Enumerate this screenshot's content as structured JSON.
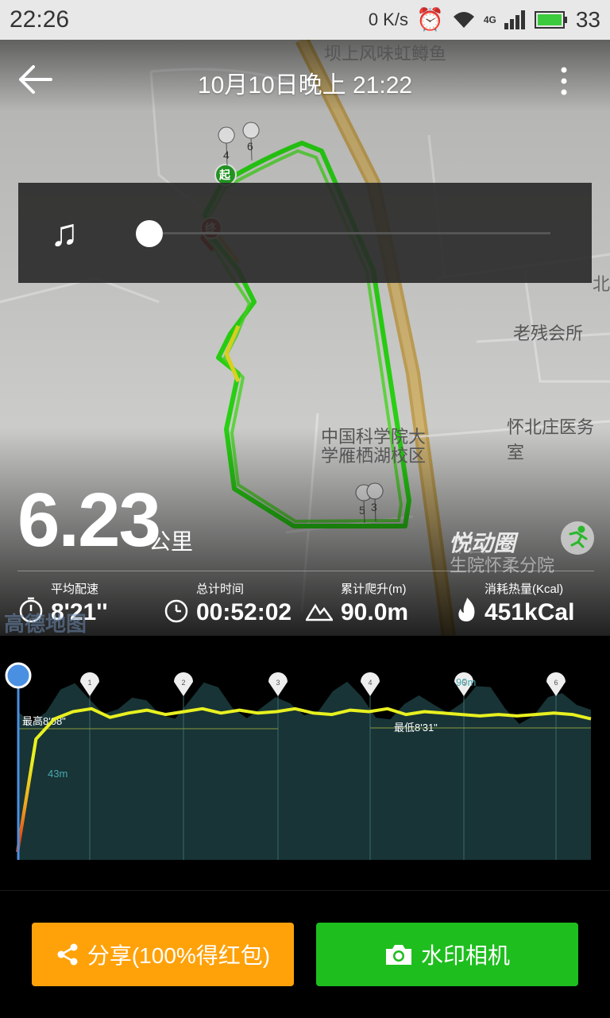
{
  "status_bar": {
    "time": "22:26",
    "net_speed": "0 K/s",
    "network_type": "4G",
    "battery": "33"
  },
  "header": {
    "title": "10月10日晚上 21:22"
  },
  "map": {
    "pois": [
      "坝上风味虹鳟鱼",
      "老残会所",
      "怀北庄医务室",
      "中国科学院大",
      "学雁栖湖校区",
      "中国",
      "生院怀柔分院",
      "北"
    ],
    "start_label": "起",
    "end_label": "终",
    "km_markers": [
      "4",
      "6",
      "5",
      "3"
    ],
    "watermark": "高德地图",
    "route_colors": {
      "fast": "#e02010",
      "mid": "#f0e020",
      "slow": "#2adc14"
    }
  },
  "music": {
    "icon": "music-note-icon",
    "progress": 0
  },
  "summary": {
    "distance": "6.23",
    "unit": "公里",
    "brand": "悦动圈"
  },
  "stats": [
    {
      "label": "平均配速",
      "value": "8'21''",
      "icon": "stopwatch-icon"
    },
    {
      "label": "总计时间",
      "value": "00:52:02",
      "icon": "clock-icon"
    },
    {
      "label": "累计爬升(m)",
      "value": "90.0m",
      "icon": "mountain-icon"
    },
    {
      "label": "消耗热量(Kcal)",
      "value": "451kCal",
      "icon": "flame-icon"
    }
  ],
  "chart_data": {
    "type": "line",
    "annotations": [
      "最高8'08\"",
      "最低8'31\"",
      "43m",
      "90m"
    ],
    "km_markers": [
      "1",
      "2",
      "3",
      "4",
      "5",
      "6"
    ],
    "series": [
      {
        "color": "#e8f020",
        "x": [
          0,
          0.2,
          0.4,
          0.6,
          0.8,
          1,
          1.2,
          1.4,
          1.6,
          1.8,
          2,
          2.2,
          2.4,
          2.6,
          2.8,
          3,
          3.2,
          3.4,
          3.6,
          3.8,
          4,
          4.2,
          4.4,
          4.6,
          4.8,
          5,
          5.2,
          5.4,
          5.6,
          5.8,
          6,
          6.2
        ],
        "values": [
          0.0,
          0.78,
          0.92,
          0.97,
          0.99,
          0.93,
          0.96,
          0.98,
          0.95,
          0.97,
          0.99,
          0.96,
          0.98,
          0.96,
          0.97,
          0.99,
          0.96,
          0.95,
          0.98,
          0.97,
          0.99,
          0.95,
          0.97,
          0.96,
          0.95,
          0.94,
          0.95,
          0.94,
          0.95,
          0.96,
          0.95,
          0.92
        ]
      }
    ],
    "elevation_fill": "#1b3a3c",
    "accent": "#4a90e2"
  },
  "buttons": {
    "share_label": "分享(100%得红包)",
    "camera_label": "水印相机"
  },
  "colors": {
    "share": "#ffa20a",
    "camera": "#1ebe1e"
  }
}
